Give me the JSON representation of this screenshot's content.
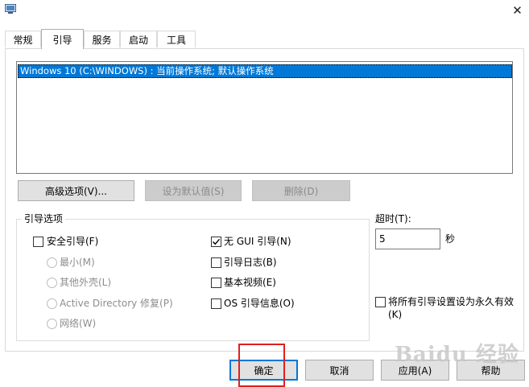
{
  "window": {
    "icon": "msconfig-app-icon",
    "close_glyph": "✕"
  },
  "tabs": [
    {
      "label": "常规"
    },
    {
      "label": "引导",
      "selected": true
    },
    {
      "label": "服务"
    },
    {
      "label": "启动"
    },
    {
      "label": "工具"
    }
  ],
  "boot_list": {
    "entries": [
      {
        "label": "Windows 10 (C:\\WINDOWS) : 当前操作系统; 默认操作系统",
        "selected": true
      }
    ]
  },
  "list_buttons": {
    "advanced_label": "高级选项(V)...",
    "set_default_label": "设为默认值(S)",
    "delete_label": "删除(D)"
  },
  "boot_options": {
    "group_label": "引导选项",
    "safe_boot": {
      "label": "安全引导(F)",
      "checked": false
    },
    "minimal": {
      "label": "最小(M)"
    },
    "alternate_shell": {
      "label": "其他外壳(L)"
    },
    "active_directory": {
      "label": "Active Directory 修复(P)"
    },
    "network": {
      "label": "网络(W)"
    },
    "no_gui_boot": {
      "label": "无 GUI 引导(N)",
      "checked": true
    },
    "boot_log": {
      "label": "引导日志(B)",
      "checked": false
    },
    "base_video": {
      "label": "基本视频(E)",
      "checked": false
    },
    "os_boot_info": {
      "label": "OS 引导信息(O)",
      "checked": false
    }
  },
  "timeout": {
    "label": "超时(T):",
    "value": "5",
    "unit": "秒"
  },
  "make_permanent": {
    "label_line1": "将所有引导设置设为永久有效",
    "label_line2": "(K)",
    "checked": false
  },
  "dialog_buttons": {
    "ok_label": "确定",
    "cancel_label": "取消",
    "apply_label": "应用(A)",
    "help_label": "帮助"
  },
  "annotation": {
    "highlight_color": "#e02020"
  },
  "watermark": {
    "text": "Baidu 经验"
  },
  "colors": {
    "selection": "#0078d7",
    "disabled_text": "#8a8a8a"
  }
}
